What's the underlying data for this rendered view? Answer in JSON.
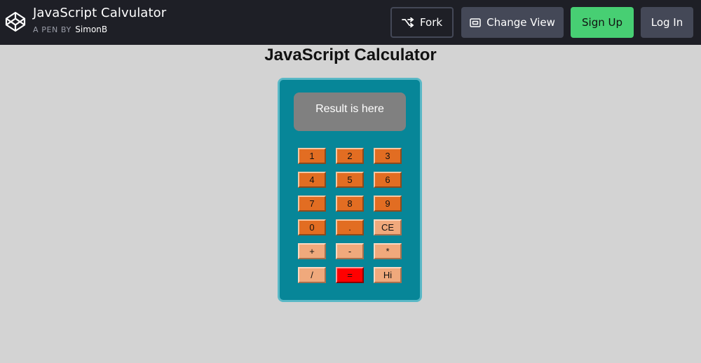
{
  "header": {
    "pen_title": "JavaScript Calvulator",
    "by_label": "A PEN BY",
    "author": "SimonB",
    "fork_label": "Fork",
    "change_view_label": "Change View",
    "signup_label": "Sign Up",
    "login_label": "Log In",
    "logo_icon": "codepen-logo-icon",
    "fork_icon": "fork-icon",
    "view_icon": "change-view-icon"
  },
  "page": {
    "heading": "JavaScript Calculator"
  },
  "calculator": {
    "display": "Result is here",
    "keys": [
      {
        "label": "1",
        "kind": "num"
      },
      {
        "label": "2",
        "kind": "num"
      },
      {
        "label": "3",
        "kind": "num"
      },
      {
        "label": "4",
        "kind": "num"
      },
      {
        "label": "5",
        "kind": "num"
      },
      {
        "label": "6",
        "kind": "num"
      },
      {
        "label": "7",
        "kind": "num"
      },
      {
        "label": "8",
        "kind": "num"
      },
      {
        "label": "9",
        "kind": "num"
      },
      {
        "label": "0",
        "kind": "num"
      },
      {
        "label": ".",
        "kind": "num"
      },
      {
        "label": "CE",
        "kind": "op"
      },
      {
        "label": "+",
        "kind": "op"
      },
      {
        "label": "-",
        "kind": "op"
      },
      {
        "label": "*",
        "kind": "op"
      },
      {
        "label": "/",
        "kind": "op"
      },
      {
        "label": "=",
        "kind": "eq"
      },
      {
        "label": "Hi",
        "kind": "op"
      }
    ]
  },
  "colors": {
    "topbar": "#1e1f26",
    "signup": "#47cf73",
    "calc_body": "#078698",
    "key_number": "#e26d22",
    "key_operator": "#f0a97c",
    "key_equals": "#ff0000",
    "display": "#808080"
  }
}
